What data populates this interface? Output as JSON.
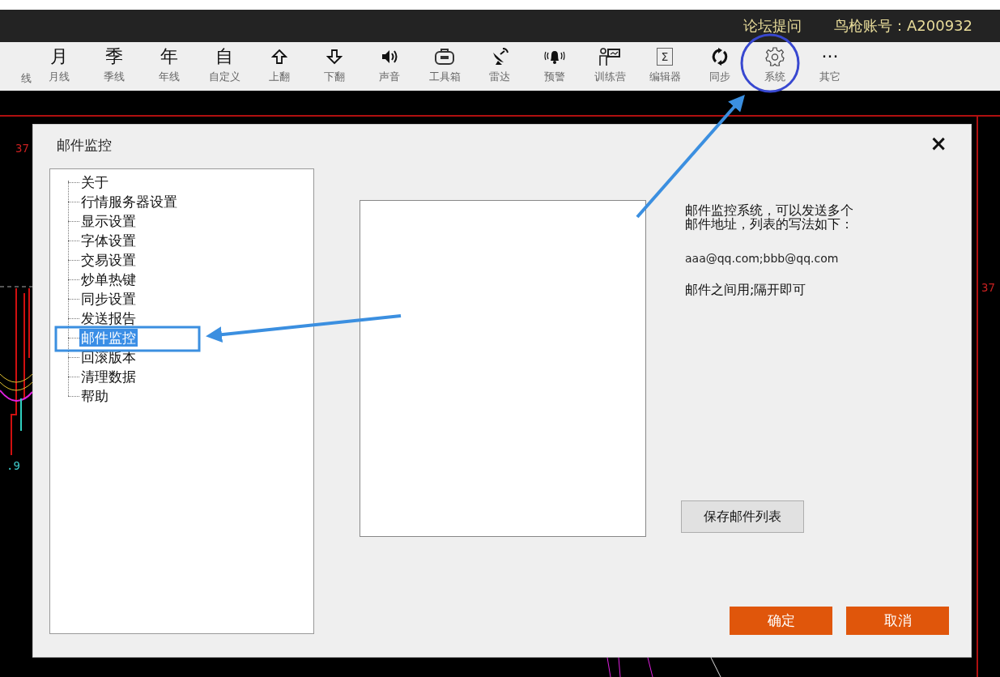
{
  "top_bar": {
    "links": [
      "论坛提问",
      "鸟枪账号：A200932"
    ]
  },
  "toolbar": [
    {
      "kind": "partial",
      "label": "线"
    },
    {
      "kind": "glyph",
      "glyph": "月",
      "label": "月线"
    },
    {
      "kind": "glyph",
      "glyph": "季",
      "label": "季线"
    },
    {
      "kind": "glyph",
      "glyph": "年",
      "label": "年线"
    },
    {
      "kind": "glyph",
      "glyph": "自",
      "label": "自定义"
    },
    {
      "kind": "icon",
      "label": "上翻"
    },
    {
      "kind": "icon",
      "label": "下翻"
    },
    {
      "kind": "icon",
      "label": "声音"
    },
    {
      "kind": "icon",
      "label": "工具箱"
    },
    {
      "kind": "icon",
      "label": "雷达"
    },
    {
      "kind": "icon",
      "label": "预警"
    },
    {
      "kind": "icon",
      "label": "训练营"
    },
    {
      "kind": "boxed",
      "glyph": "Σ",
      "label": "编辑器"
    },
    {
      "kind": "icon",
      "label": "同步"
    },
    {
      "kind": "icon",
      "label": "系统"
    },
    {
      "kind": "glyph",
      "glyph": "···",
      "label": "其它"
    }
  ],
  "chart": {
    "left_price": "37",
    "left_value": ".9",
    "right_price": "37"
  },
  "dialog": {
    "title": "邮件监控",
    "close": "×",
    "tree": [
      {
        "label": "关于",
        "selected": false
      },
      {
        "label": "行情服务器设置",
        "selected": false
      },
      {
        "label": "显示设置",
        "selected": false
      },
      {
        "label": "字体设置",
        "selected": false
      },
      {
        "label": "交易设置",
        "selected": false
      },
      {
        "label": "炒单热键",
        "selected": false
      },
      {
        "label": "同步设置",
        "selected": false
      },
      {
        "label": "发送报告",
        "selected": false
      },
      {
        "label": "邮件监控",
        "selected": true
      },
      {
        "label": "回滚版本",
        "selected": false
      },
      {
        "label": "清理数据",
        "selected": false
      },
      {
        "label": "帮助",
        "selected": false
      }
    ],
    "info": [
      "邮件监控系统，可以发送多个",
      "邮件地址，列表的写法如下："
    ],
    "example": "aaa@qq.com;bbb@qq.com",
    "note": "邮件之间用;隔开即可",
    "save_button": "保存邮件列表",
    "buttons": [
      "确定",
      "取消"
    ]
  }
}
